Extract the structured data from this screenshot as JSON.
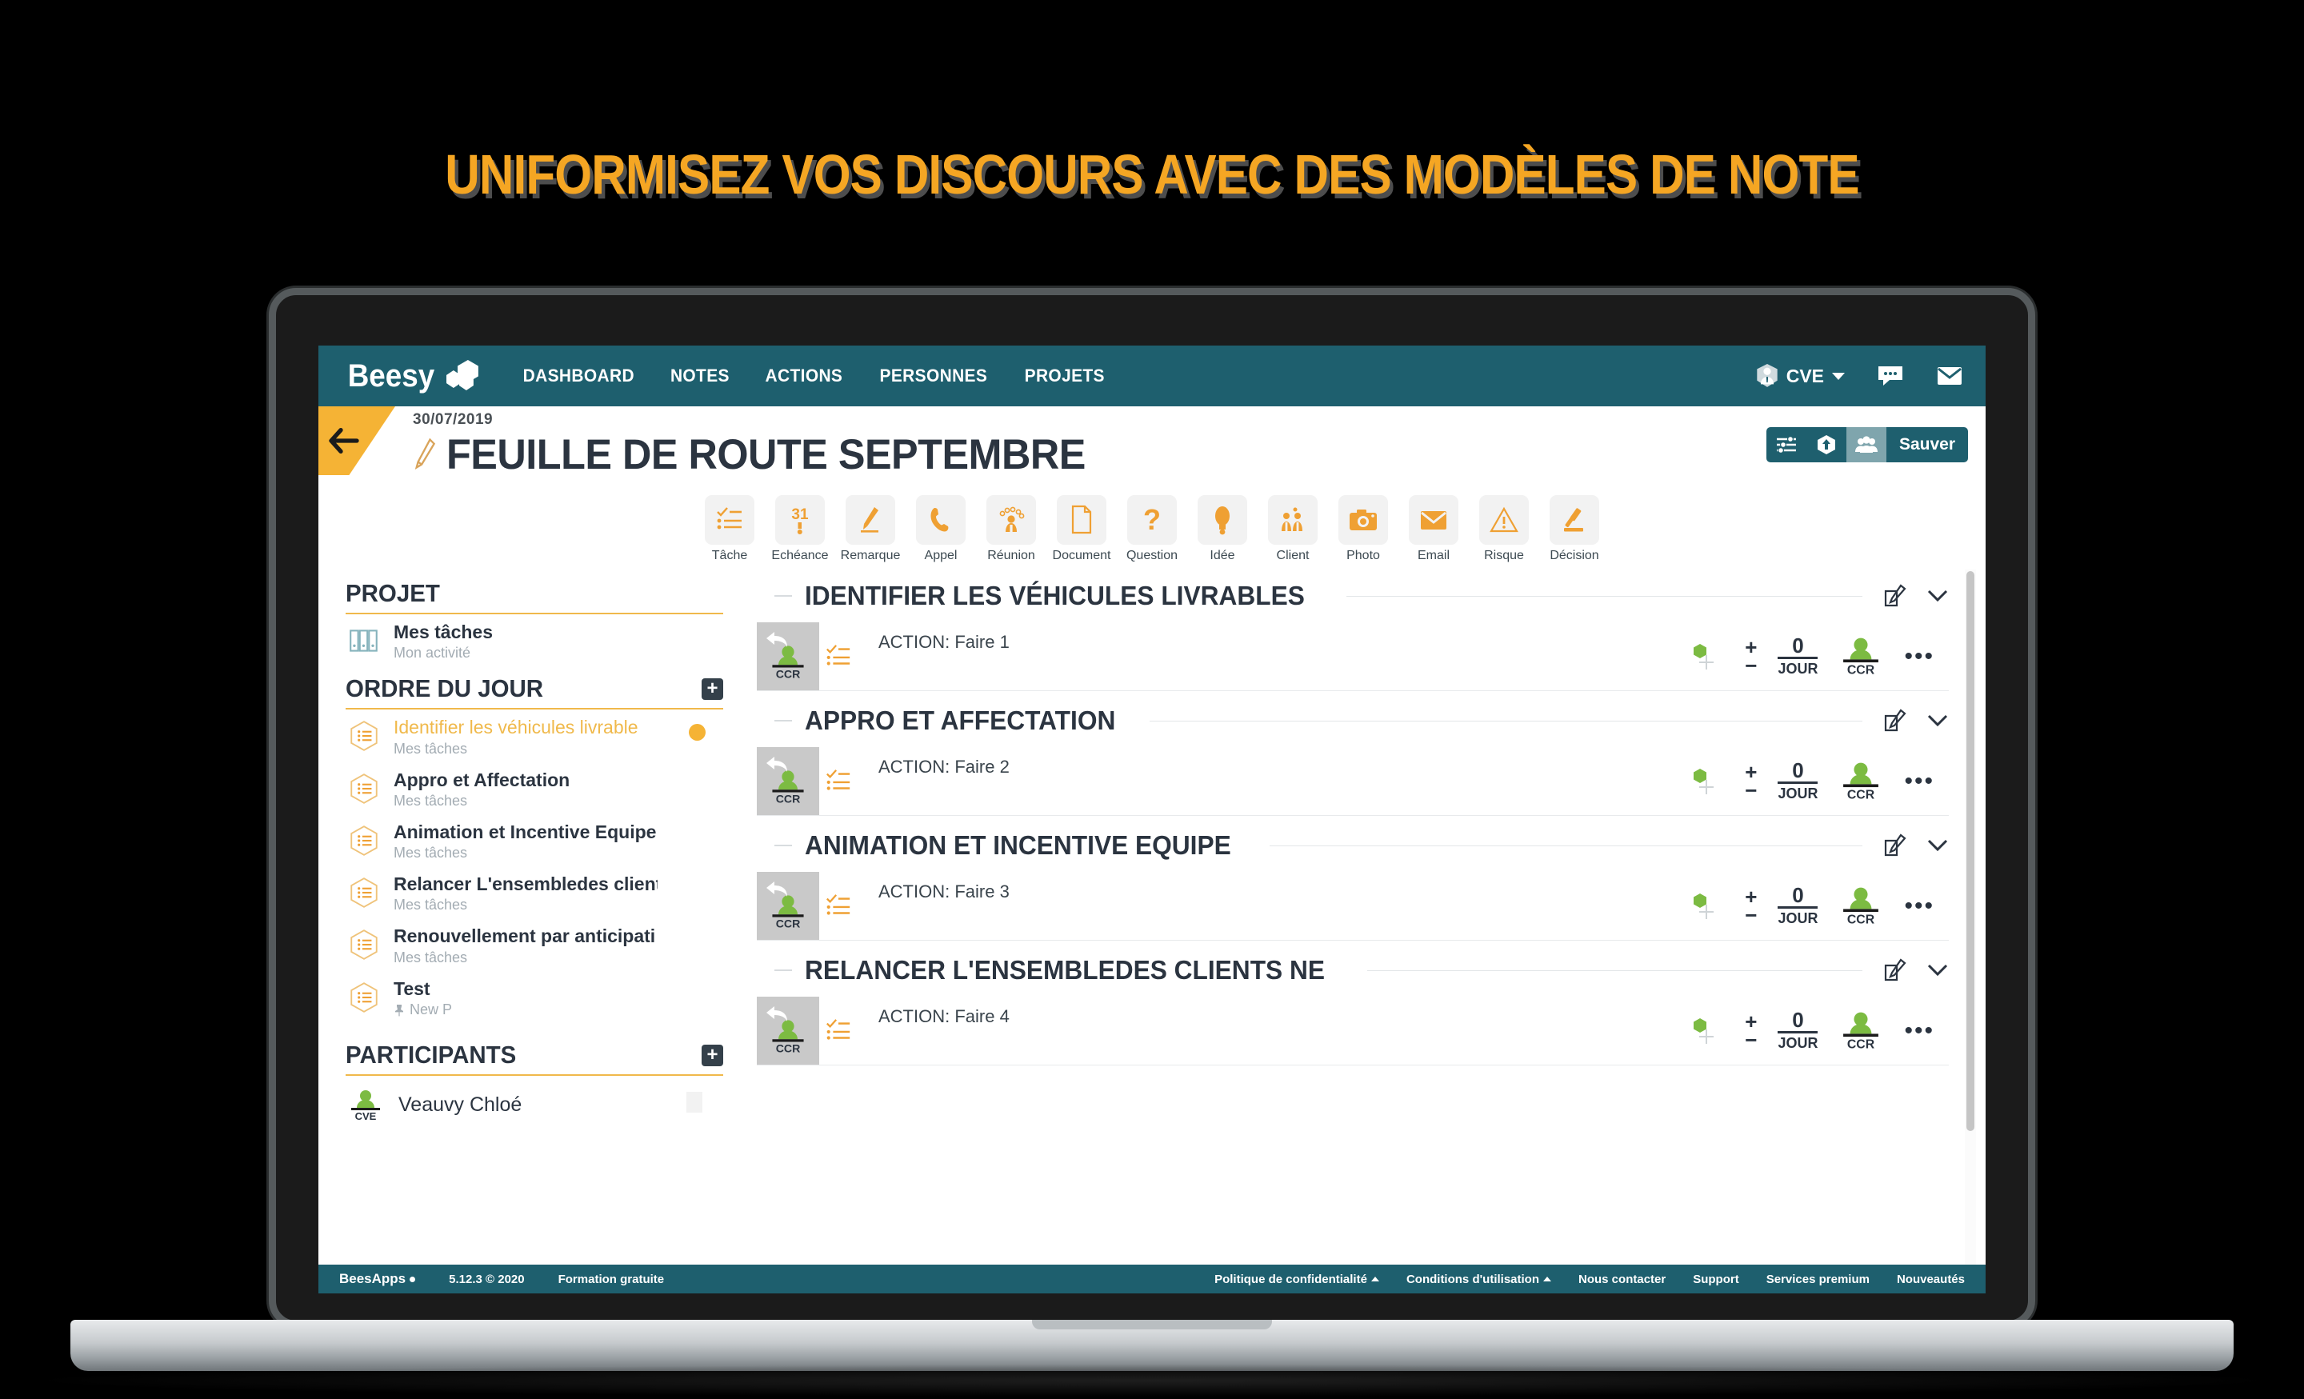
{
  "headline": "UNIFORMISEZ VOS DISCOURS AVEC DES MODÈLES DE NOTE",
  "colors": {
    "brand_teal": "#1e5f6e",
    "accent_orange": "#F5B335",
    "accent_yellow": "#F0B94B",
    "green": "#7CBB42",
    "text_dark": "#2b3440"
  },
  "nav": {
    "brand": "Beesy",
    "links": [
      {
        "label": "DASHBOARD"
      },
      {
        "label": "NOTES"
      },
      {
        "label": "ACTIONS"
      },
      {
        "label": "PERSONNES"
      },
      {
        "label": "PROJETS"
      }
    ],
    "user": "CVE",
    "icons": [
      "user-icon",
      "chat-icon",
      "mail-icon"
    ]
  },
  "page_header": {
    "date": "30/07/2019",
    "title": "FEUILLE DE ROUTE SEPTEMBRE",
    "save_label": "Sauver",
    "action_icons": [
      "sliders-icon",
      "upload-icon",
      "people-icon"
    ]
  },
  "typebar": [
    {
      "label": "Tâche",
      "icon": "task-icon"
    },
    {
      "label": "Echéance",
      "icon": "calendar-31-icon"
    },
    {
      "label": "Remarque",
      "icon": "pencil-icon"
    },
    {
      "label": "Appel",
      "icon": "phone-icon"
    },
    {
      "label": "Réunion",
      "icon": "meeting-icon"
    },
    {
      "label": "Document",
      "icon": "document-icon"
    },
    {
      "label": "Question",
      "icon": "question-icon"
    },
    {
      "label": "Idée",
      "icon": "bulb-icon"
    },
    {
      "label": "Client",
      "icon": "client-icon"
    },
    {
      "label": "Photo",
      "icon": "camera-icon"
    },
    {
      "label": "Email",
      "icon": "envelope-icon"
    },
    {
      "label": "Risque",
      "icon": "warning-icon"
    },
    {
      "label": "Décision",
      "icon": "gavel-icon"
    }
  ],
  "sidebar": {
    "projet": {
      "title": "PROJET",
      "item": {
        "name": "Mes tâches",
        "sub": "Mon activité",
        "icon": "binders-icon"
      }
    },
    "ordre": {
      "title": "ORDRE DU JOUR",
      "items": [
        {
          "name": "Identifier les véhicules livrable",
          "sub": "Mes tâches",
          "selected": true,
          "dot": true
        },
        {
          "name": "Appro et Affectation",
          "sub": "Mes tâches",
          "selected": false,
          "dot": false
        },
        {
          "name": "Animation et Incentive Equipe",
          "sub": "Mes tâches",
          "selected": false,
          "dot": false
        },
        {
          "name": "Relancer L'ensembledes client",
          "sub": "Mes tâches",
          "selected": false,
          "dot": false
        },
        {
          "name": "Renouvellement par anticipati",
          "sub": "Mes tâches",
          "selected": false,
          "dot": false
        },
        {
          "name": "Test",
          "sub": "New P",
          "selected": false,
          "dot": false,
          "pin": true
        }
      ]
    },
    "participants": {
      "title": "PARTICIPANTS",
      "items": [
        {
          "name": "Veauvy Chloé",
          "initials": "CVE"
        }
      ]
    }
  },
  "sections": [
    {
      "title": "IDENTIFIER LES VÉHICULES LIVRABLES",
      "action": {
        "text": "ACTION: Faire 1",
        "owner": "CCR",
        "count": "0",
        "unit": "JOUR",
        "assignee": "CCR"
      }
    },
    {
      "title": "APPRO ET AFFECTATION",
      "action": {
        "text": "ACTION: Faire 2",
        "owner": "CCR",
        "count": "0",
        "unit": "JOUR",
        "assignee": "CCR"
      }
    },
    {
      "title": "ANIMATION ET INCENTIVE EQUIPE",
      "action": {
        "text": "ACTION: Faire 3",
        "owner": "CCR",
        "count": "0",
        "unit": "JOUR",
        "assignee": "CCR"
      }
    },
    {
      "title": "RELANCER L'ENSEMBLEDES CLIENTS NE",
      "action": {
        "text": "ACTION: Faire 4",
        "owner": "CCR",
        "count": "0",
        "unit": "JOUR",
        "assignee": "CCR"
      }
    }
  ],
  "footer": {
    "brand": "BeesApps",
    "version": "5.12.3 © 2020",
    "training": "Formation gratuite",
    "links": [
      {
        "label": "Politique de confidentialité",
        "caret": true
      },
      {
        "label": "Conditions d'utilisation",
        "caret": true
      },
      {
        "label": "Nous contacter",
        "caret": false
      },
      {
        "label": "Support",
        "caret": false
      },
      {
        "label": "Services premium",
        "caret": false
      },
      {
        "label": "Nouveautés",
        "caret": false
      }
    ]
  }
}
